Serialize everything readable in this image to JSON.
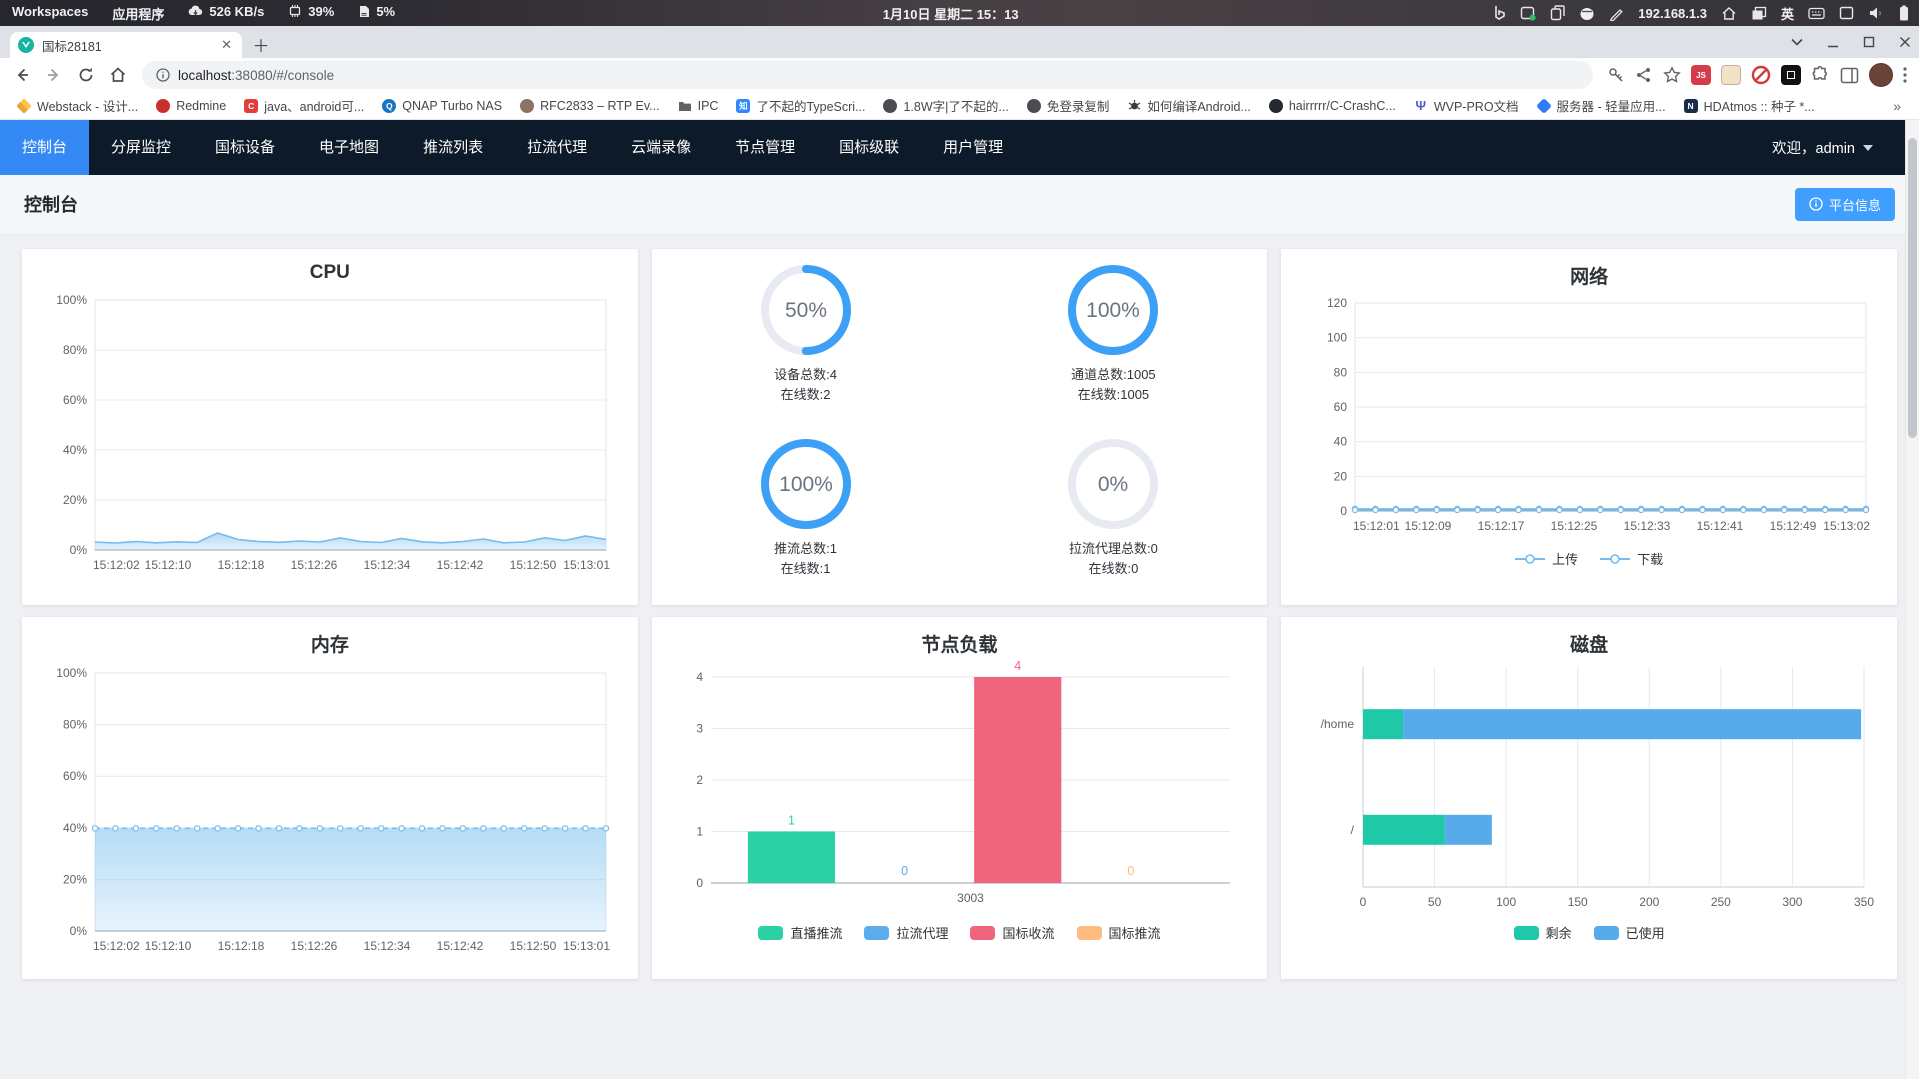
{
  "colors": {
    "accent": "#409eff",
    "nav_active": "#3489f5",
    "ring_blue": "#3da0f7",
    "ring_track": "#e7ebf1",
    "line_blue": "#74bbee",
    "green": "#2ad1a5",
    "blue": "#5badee",
    "pink": "#f0647e",
    "orange": "#ffbb80"
  },
  "system_bar": {
    "workspaces": "Workspaces",
    "applications": "应用程序",
    "net_speed": "526 KB/s",
    "cpu": "39%",
    "mem": "5%",
    "clock": "1月10日 星期二 15：13",
    "ip": "192.168.1.3",
    "lang": "英"
  },
  "browser": {
    "tab_title": "国标28181",
    "url_host": "localhost",
    "url_rest": ":38080/#/console",
    "ext_js_label": "JS",
    "bookmarks_overflow": "»",
    "bookmarks": [
      {
        "label": "Webstack - 设计...",
        "shape": "layers",
        "color": "#f2b63c",
        "glyph": ""
      },
      {
        "label": "Redmine",
        "shape": "circle",
        "color": "#c9302c",
        "glyph": ""
      },
      {
        "label": "java、android可...",
        "shape": "square",
        "color": "#e23c3c",
        "glyph": "C"
      },
      {
        "label": "QNAP Turbo NAS",
        "shape": "circle",
        "color": "#1a74c4",
        "glyph": "Q"
      },
      {
        "label": "RFC2833 – RTP Ev...",
        "shape": "circle",
        "color": "#8a7265",
        "glyph": ""
      },
      {
        "label": "IPC",
        "shape": "folder",
        "color": "#5f6368",
        "glyph": ""
      },
      {
        "label": "了不起的TypeScri...",
        "shape": "square",
        "color": "#2f88ff",
        "glyph": "知"
      },
      {
        "label": "1.8W字|了不起的...",
        "shape": "circle",
        "color": "#4c4c52",
        "glyph": ""
      },
      {
        "label": "免登录复制",
        "shape": "circle",
        "color": "#4c4c52",
        "glyph": ""
      },
      {
        "label": "如何编译Android...",
        "shape": "bug",
        "color": "#3a3a3a",
        "glyph": ""
      },
      {
        "label": "hairrrrr/C-CrashC...",
        "shape": "circle",
        "color": "#24292f",
        "glyph": ""
      },
      {
        "label": "WVP-PRO文档",
        "shape": "glyph",
        "color": "#4f5bd1",
        "glyph": "Ψ"
      },
      {
        "label": "服务器 - 轻量应用...",
        "shape": "diamond",
        "color": "#2f7cf6",
        "glyph": ""
      },
      {
        "label": "HDAtmos :: 种子 *...",
        "shape": "square",
        "color": "#1c2b4a",
        "glyph": "N"
      }
    ]
  },
  "nav": {
    "active_index": 0,
    "welcome": "欢迎，admin",
    "items": [
      "控制台",
      "分屏监控",
      "国标设备",
      "电子地图",
      "推流列表",
      "拉流代理",
      "云端录像",
      "节点管理",
      "国标级联",
      "用户管理"
    ]
  },
  "header": {
    "title": "控制台",
    "platform_info": "平台信息"
  },
  "rings": [
    {
      "pct": 50,
      "text": "50%",
      "line1": "设备总数:4",
      "line2": "在线数:2"
    },
    {
      "pct": 100,
      "text": "100%",
      "line1": "通道总数:1005",
      "line2": "在线数:1005"
    },
    {
      "pct": 100,
      "text": "100%",
      "line1": "推流总数:1",
      "line2": "在线数:1"
    },
    {
      "pct": 0,
      "text": "0%",
      "line1": "拉流代理总数:0",
      "line2": "在线数:0"
    }
  ],
  "chart_data": [
    {
      "id": "cpu",
      "type": "area",
      "title": "CPU",
      "ymax": 100,
      "grid": true,
      "yticks": [
        "0%",
        "20%",
        "40%",
        "60%",
        "80%",
        "100%"
      ],
      "x_labels": [
        "15:12:02",
        "15:12:10",
        "15:12:18",
        "15:12:26",
        "15:12:34",
        "15:12:42",
        "15:12:50",
        "15:13:01"
      ],
      "values": [
        3.2,
        2.8,
        3.4,
        2.9,
        3.3,
        3.0,
        6.8,
        4.2,
        3.4,
        3.1,
        3.6,
        3.2,
        4.8,
        3.4,
        3.0,
        4.6,
        3.3,
        2.9,
        3.4,
        4.4,
        2.9,
        3.2,
        4.9,
        3.8,
        5.6,
        4.2
      ],
      "color": "#74bbee"
    },
    {
      "id": "network",
      "type": "line",
      "title": "网络",
      "ymax": 120,
      "grid": true,
      "markers": true,
      "yticks": [
        "0",
        "20",
        "40",
        "60",
        "80",
        "100",
        "120"
      ],
      "x_labels": [
        "15:12:01",
        "15:12:09",
        "15:12:17",
        "15:12:25",
        "15:12:33",
        "15:12:41",
        "15:12:49",
        "15:13:02"
      ],
      "legend_style": "line",
      "series": [
        {
          "name": "上传",
          "color": "#74bbee",
          "values": [
            1.2,
            1.2,
            1.2,
            1.2,
            1.2,
            1.2,
            1.2,
            1.2,
            1.2,
            1.2,
            1.2,
            1.2,
            1.2,
            1.2,
            1.2,
            1.2,
            1.2,
            1.2,
            1.2,
            1.2,
            1.2,
            1.2,
            1.2,
            1.2,
            1.2,
            1.2
          ]
        },
        {
          "name": "下载",
          "color": "#74bbee",
          "values": [
            0.6,
            0.6,
            0.6,
            0.6,
            0.6,
            0.6,
            0.6,
            0.6,
            0.6,
            0.6,
            0.6,
            0.6,
            0.6,
            0.6,
            0.6,
            0.6,
            0.6,
            0.6,
            0.6,
            0.6,
            0.6,
            0.6,
            0.6,
            0.6,
            0.6,
            0.6
          ]
        }
      ]
    },
    {
      "id": "memory",
      "type": "area",
      "title": "内存",
      "ymax": 100,
      "grid": true,
      "dashed": true,
      "markers": true,
      "yticks": [
        "0%",
        "20%",
        "40%",
        "60%",
        "80%",
        "100%"
      ],
      "x_labels": [
        "15:12:02",
        "15:12:10",
        "15:12:18",
        "15:12:26",
        "15:12:34",
        "15:12:42",
        "15:12:50",
        "15:13:01"
      ],
      "values": [
        39.8,
        39.8,
        39.8,
        39.8,
        39.8,
        39.8,
        39.8,
        39.8,
        39.8,
        39.8,
        39.8,
        39.8,
        39.8,
        39.8,
        39.8,
        39.8,
        39.8,
        39.8,
        39.8,
        39.8,
        39.8,
        39.8,
        39.8,
        39.8,
        39.8,
        39.8
      ],
      "color": "#79bfef"
    },
    {
      "id": "nodeload",
      "type": "bar",
      "title": "节点负载",
      "ymax": 4,
      "category": "3003",
      "yticks": [
        "0",
        "1",
        "2",
        "3",
        "4"
      ],
      "series": [
        {
          "name": "直播推流",
          "value": 1,
          "color": "#2ad1a5"
        },
        {
          "name": "拉流代理",
          "value": 0,
          "color": "#5badee"
        },
        {
          "name": "国标收流",
          "value": 4,
          "color": "#f0647e"
        },
        {
          "name": "国标推流",
          "value": 0,
          "color": "#ffbb80"
        }
      ]
    },
    {
      "id": "disk",
      "type": "hbar",
      "title": "磁盘",
      "xmax": 350,
      "xticks": [
        "0",
        "50",
        "100",
        "150",
        "200",
        "250",
        "300",
        "350"
      ],
      "categories": [
        "/home",
        "/"
      ],
      "series": [
        {
          "name": "剩余",
          "color": "#1fc9a7",
          "values": [
            28,
            57
          ]
        },
        {
          "name": "已使用",
          "color": "#57abeb",
          "values": [
            320,
            33
          ]
        }
      ]
    }
  ]
}
